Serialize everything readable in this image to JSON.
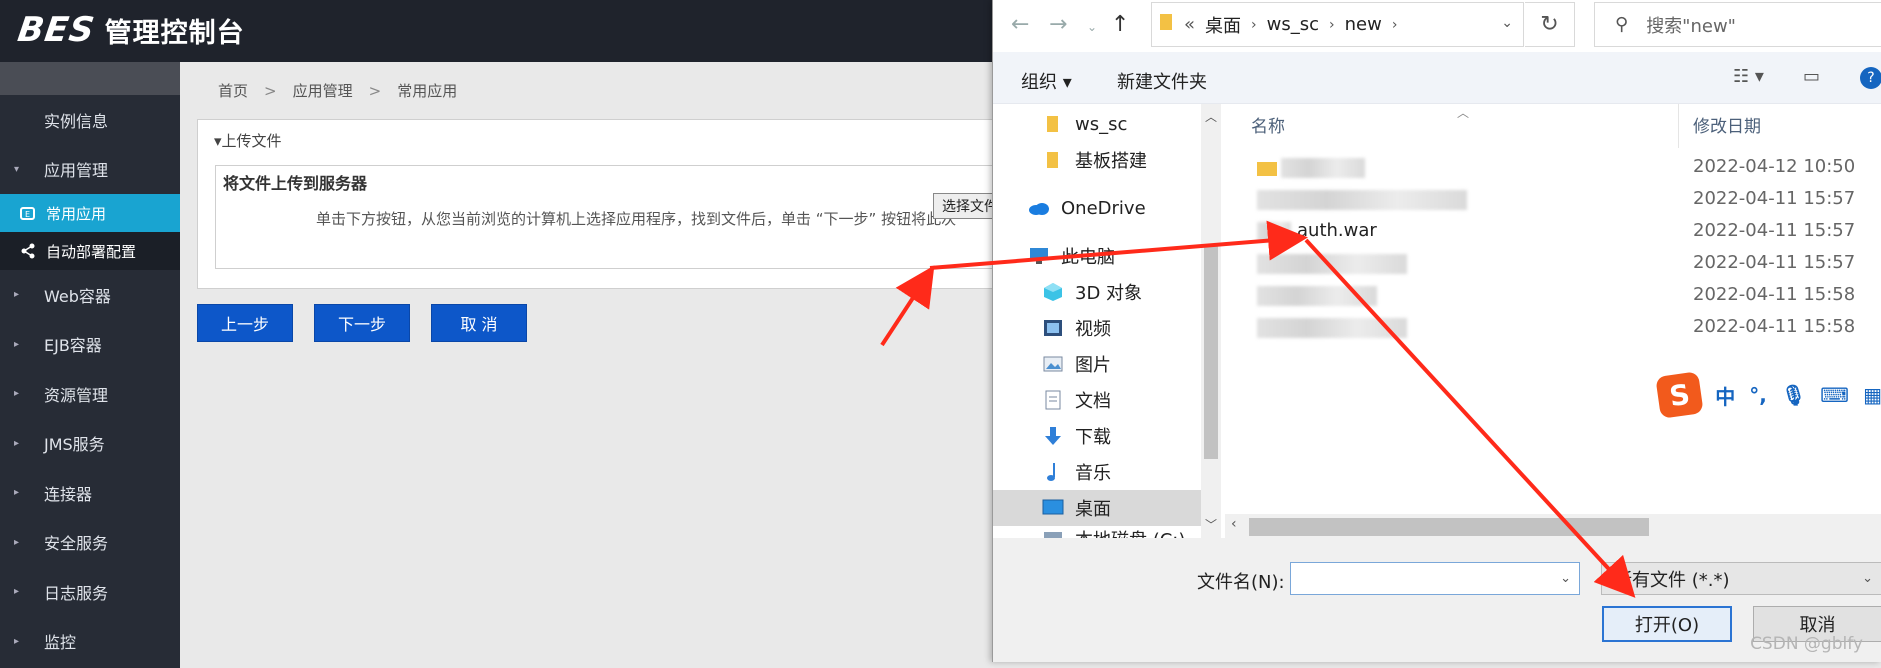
{
  "app": {
    "brand": "BES",
    "title": "管理控制台"
  },
  "sidebar": {
    "items": [
      {
        "label": "实例信息"
      },
      {
        "label": "应用管理"
      },
      {
        "label": "常用应用"
      },
      {
        "label": "自动部署配置"
      },
      {
        "label": "Web容器"
      },
      {
        "label": "EJB容器"
      },
      {
        "label": "资源管理"
      },
      {
        "label": "JMS服务"
      },
      {
        "label": "连接器"
      },
      {
        "label": "安全服务"
      },
      {
        "label": "日志服务"
      },
      {
        "label": "监控"
      }
    ]
  },
  "breadcrumb": [
    "首页",
    "应用管理",
    "常用应用"
  ],
  "upload": {
    "legend": "上传文件",
    "title": "将文件上传到服务器",
    "description": "单击下方按钮，从您当前浏览的计算机上选择应用程序，找到文件后，单击 “下一步” 按钮将此次",
    "choose_file": "选择文件"
  },
  "actions": {
    "prev": "上一步",
    "next": "下一步",
    "cancel": "取 消"
  },
  "dialog": {
    "address": {
      "overflow": "«",
      "path": [
        "桌面",
        "ws_sc",
        "new"
      ]
    },
    "search_placeholder": "搜索\"new\"",
    "toolbar": {
      "organize": "组织 ▾",
      "new_folder": "新建文件夹"
    },
    "tree": [
      {
        "label": "ws_sc",
        "icon": "folder-icon"
      },
      {
        "label": "基板搭建",
        "icon": "folder-icon"
      },
      {
        "label": "OneDrive",
        "icon": "cloud-icon"
      },
      {
        "label": "此电脑",
        "icon": "computer-icon"
      },
      {
        "label": "3D 对象",
        "icon": "cube-icon"
      },
      {
        "label": "视频",
        "icon": "video-icon"
      },
      {
        "label": "图片",
        "icon": "picture-icon"
      },
      {
        "label": "文档",
        "icon": "document-icon"
      },
      {
        "label": "下载",
        "icon": "download-icon"
      },
      {
        "label": "音乐",
        "icon": "music-icon"
      },
      {
        "label": "桌面",
        "icon": "desktop-icon"
      },
      {
        "label": "本地磁盘 (C:)",
        "icon": "disk-icon"
      }
    ],
    "columns": {
      "name": "名称",
      "modified": "修改日期"
    },
    "files": [
      {
        "name": "",
        "date": "2022-04-12 10:50"
      },
      {
        "name": "",
        "date": "2022-04-11 15:57"
      },
      {
        "name": "auth.war",
        "date": "2022-04-11 15:57"
      },
      {
        "name": "",
        "date": "2022-04-11 15:57"
      },
      {
        "name": "",
        "date": "2022-04-11 15:58"
      },
      {
        "name": "",
        "date": "2022-04-11 15:58"
      }
    ],
    "ime": {
      "logo": "S",
      "mode": "中",
      "punct": "°,"
    },
    "filename_label": "文件名(N):",
    "filename_value": "",
    "filter": "所有文件 (*.*)",
    "open": "打开(O)",
    "cancel": "取消"
  },
  "watermark": "CSDN @gblfy",
  "colors": {
    "accent": "#19a4d1",
    "button_blue": "#0d57c9",
    "annotation_red": "#ff2a1a"
  }
}
